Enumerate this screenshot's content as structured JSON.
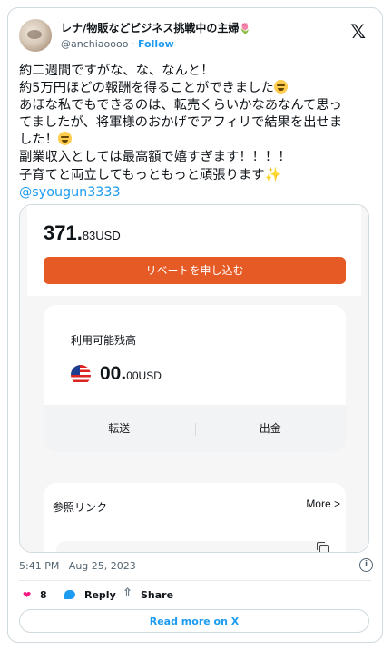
{
  "header": {
    "display_name": "レナ/物販などビジネス挑戦中の主婦",
    "display_name_emoji": "tulip",
    "handle": "@anchiaoooo",
    "separator": " · ",
    "follow_label": "Follow"
  },
  "tweet": {
    "lines": [
      "約二週間ですがな、な、なんと！",
      "約5万円ほどの報酬を得ることができました",
      "あほな私でもできるのは、転売くらいかなあなんて思っ",
      "てましたが、将軍様のおかげでアフィリで結果を出せま",
      "した！",
      "副業収入としては最高額で嬉すぎます！！！！",
      "子育てと両立してもっともっと頑張ります"
    ],
    "mention": "@syougun3333",
    "emojis": [
      "laughing-face",
      "grinning-face",
      "sparkles"
    ]
  },
  "media": {
    "amount_main": "371.",
    "amount_sub": "83USD",
    "rebate_button": "リベートを申し込む",
    "balance_label": "利用可能残高",
    "balance_main": "00.",
    "balance_sub": "00USD",
    "transfer_label": "転送",
    "withdraw_label": "出金",
    "ref_title": "参照リンク",
    "ref_more": "More >"
  },
  "meta": {
    "timestamp": "5:41 PM · Aug 25, 2023"
  },
  "actions": {
    "likes": "8",
    "reply_label": "Reply",
    "share_label": "Share",
    "read_more": "Read more on X"
  },
  "colors": {
    "accent": "#1d9bf0",
    "like": "#f91880",
    "rebate_button": "#e55a25"
  }
}
